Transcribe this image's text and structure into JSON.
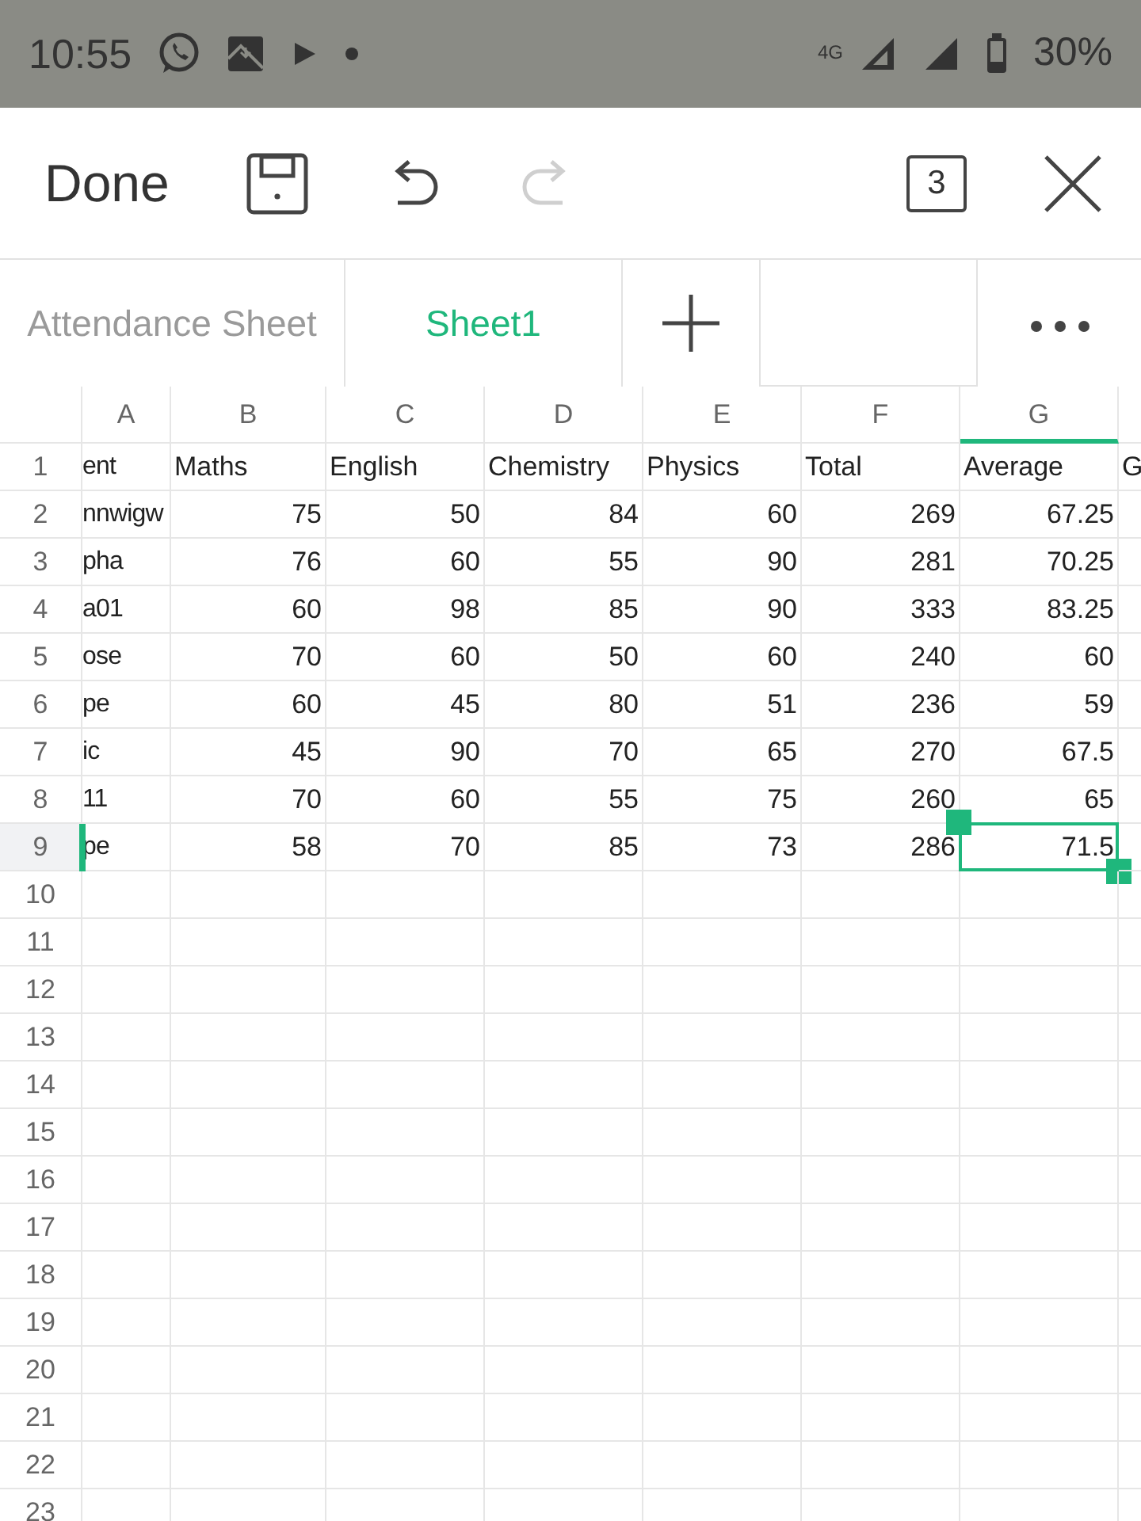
{
  "status_bar": {
    "time": "10:55",
    "network": "4G",
    "battery": "30%"
  },
  "toolbar": {
    "done": "Done",
    "redo": {
      "disabled": true
    },
    "sheet_count": "3"
  },
  "tabs": [
    {
      "label": "Attendance Sheet",
      "selected": false
    },
    {
      "label": "Sheet1",
      "selected": true
    }
  ],
  "grid": {
    "columns": [
      {
        "label": "A",
        "selected": false
      },
      {
        "label": "B",
        "selected": false
      },
      {
        "label": "C",
        "selected": false
      },
      {
        "label": "D",
        "selected": false
      },
      {
        "label": "E",
        "selected": false
      },
      {
        "label": "F",
        "selected": false
      },
      {
        "label": "G",
        "selected": true
      }
    ],
    "rows": [
      {
        "number": "1",
        "kind": "header",
        "selected": false,
        "cells": [
          "ent",
          "Maths",
          "English",
          "Chemistry",
          "Physics",
          "Total",
          "Average",
          "G"
        ]
      },
      {
        "number": "2",
        "kind": "data",
        "selected": false,
        "cells": [
          "nnwigw",
          "75",
          "50",
          "84",
          "60",
          "269",
          "67.25"
        ]
      },
      {
        "number": "3",
        "kind": "data",
        "selected": false,
        "cells": [
          "pha",
          "76",
          "60",
          "55",
          "90",
          "281",
          "70.25"
        ]
      },
      {
        "number": "4",
        "kind": "data",
        "selected": false,
        "cells": [
          "a01",
          "60",
          "98",
          "85",
          "90",
          "333",
          "83.25"
        ]
      },
      {
        "number": "5",
        "kind": "data",
        "selected": false,
        "cells": [
          "ose",
          "70",
          "60",
          "50",
          "60",
          "240",
          "60"
        ]
      },
      {
        "number": "6",
        "kind": "data",
        "selected": false,
        "cells": [
          "pe",
          "60",
          "45",
          "80",
          "51",
          "236",
          "59"
        ]
      },
      {
        "number": "7",
        "kind": "data",
        "selected": false,
        "cells": [
          "ic",
          "45",
          "90",
          "70",
          "65",
          "270",
          "67.5"
        ]
      },
      {
        "number": "8",
        "kind": "data",
        "selected": false,
        "cells": [
          "11",
          "70",
          "60",
          "55",
          "75",
          "260",
          "65"
        ]
      },
      {
        "number": "9",
        "kind": "data",
        "selected": true,
        "cells": [
          "pe",
          "58",
          "70",
          "85",
          "73",
          "286",
          "71.5"
        ]
      },
      {
        "number": "10",
        "kind": "empty",
        "selected": false
      },
      {
        "number": "11",
        "kind": "empty",
        "selected": false
      },
      {
        "number": "12",
        "kind": "empty",
        "selected": false
      },
      {
        "number": "13",
        "kind": "empty",
        "selected": false
      },
      {
        "number": "14",
        "kind": "empty",
        "selected": false
      },
      {
        "number": "15",
        "kind": "empty",
        "selected": false
      },
      {
        "number": "16",
        "kind": "empty",
        "selected": false
      },
      {
        "number": "17",
        "kind": "empty",
        "selected": false
      },
      {
        "number": "18",
        "kind": "empty",
        "selected": false
      },
      {
        "number": "19",
        "kind": "empty",
        "selected": false
      },
      {
        "number": "20",
        "kind": "empty",
        "selected": false
      },
      {
        "number": "21",
        "kind": "empty",
        "selected": false
      },
      {
        "number": "22",
        "kind": "empty",
        "selected": false
      },
      {
        "number": "23",
        "kind": "empty",
        "selected": false
      }
    ]
  }
}
